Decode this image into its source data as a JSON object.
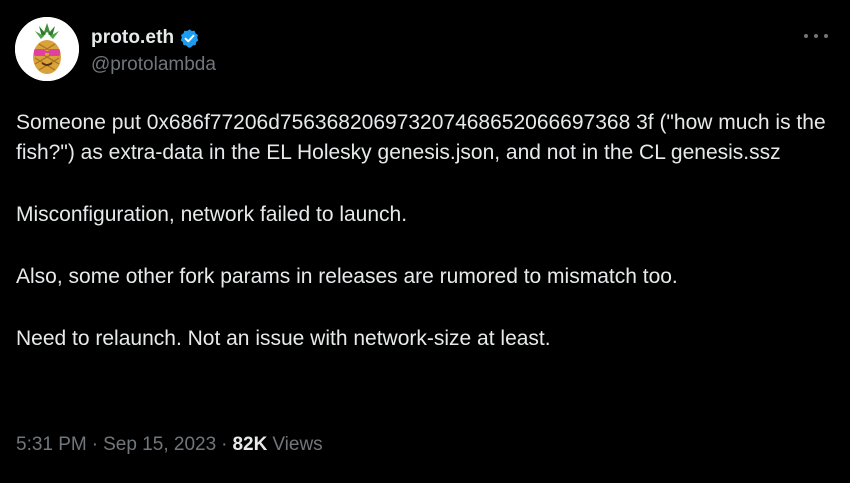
{
  "author": {
    "display_name": "proto.eth",
    "handle": "@protolambda",
    "avatar_icon": "pineapple-avatar-icon",
    "verified_icon": "verified-badge-icon",
    "verified_color": "#1d9bf0"
  },
  "menu": {
    "icon": "more-options-icon"
  },
  "tweet": {
    "paragraphs": [
      "Someone put 0x686f77206d756368206973207468652066697368 3f (\"how much is the fish?\") as extra-data in the EL Holesky genesis.json, and not in the CL genesis.ssz",
      "Misconfiguration, network failed to launch.",
      "Also, some other fork params in releases are rumored to mismatch too.",
      "Need to relaunch. Not an issue with network-size at least."
    ]
  },
  "meta": {
    "time": "5:31 PM",
    "separator": "·",
    "date": "Sep 15, 2023",
    "views_count": "82K",
    "views_label": "Views"
  },
  "colors": {
    "background": "#000000",
    "text_primary": "#e7e9ea",
    "text_secondary": "#71767b"
  }
}
